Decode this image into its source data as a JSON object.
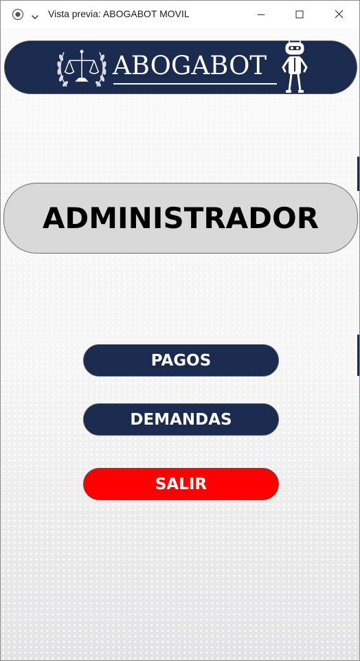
{
  "window": {
    "title": "Vista previa: ABOGABOT MOVIL",
    "controls": [
      "minimize",
      "maximize",
      "close"
    ]
  },
  "header": {
    "brand": "ABOGABOT",
    "icons": [
      "scales-of-justice-laurel-icon",
      "robot-mascot-icon"
    ],
    "color": "#1b2a4f"
  },
  "role_banner": {
    "label": "ADMINISTRADOR"
  },
  "menu": {
    "pagos_label": "PAGOS",
    "demandas_label": "DEMANDAS",
    "salir_label": "SALIR"
  },
  "colors": {
    "navy": "#1b2a4f",
    "exit_red": "#ff0000",
    "banner_grey": "#dad9da"
  }
}
